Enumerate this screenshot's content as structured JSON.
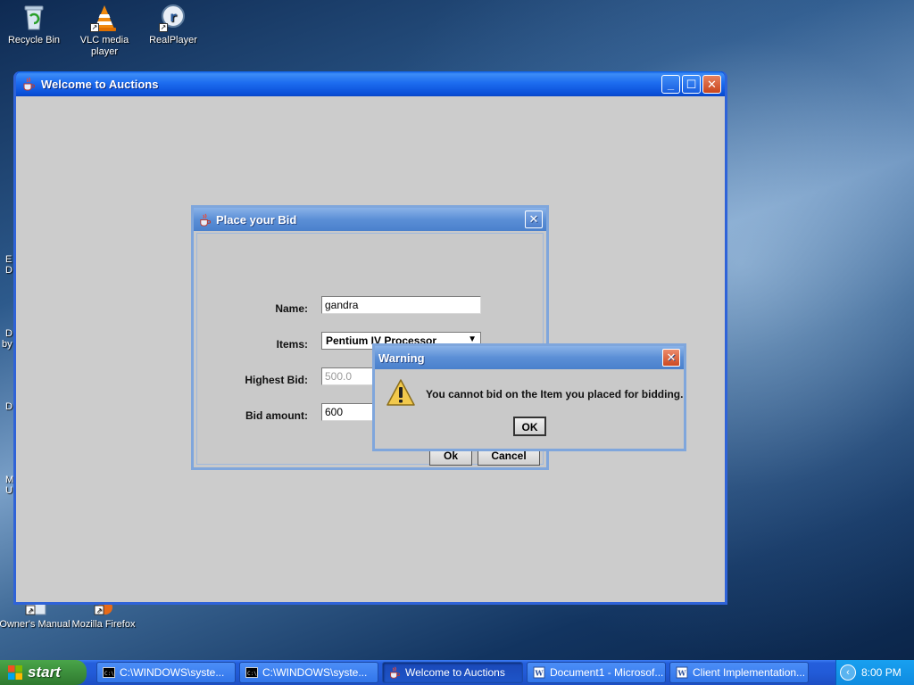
{
  "desktop": {
    "icons": [
      {
        "label": "Recycle Bin",
        "icon": "recycle-bin-icon"
      },
      {
        "label": "VLC media player",
        "icon": "vlc-icon"
      },
      {
        "label": "RealPlayer",
        "icon": "realplayer-icon"
      },
      {
        "label": "Owner's Manual",
        "icon": "manual-icon"
      },
      {
        "label": "Mozilla Firefox",
        "icon": "firefox-icon"
      }
    ],
    "edge_fragments": [
      "E",
      "D",
      "D",
      "by",
      "D",
      "M",
      "U"
    ]
  },
  "main_window": {
    "title": "Welcome to Auctions",
    "icon": "java-cup-icon",
    "controls": {
      "minimize": "minimize-icon",
      "maximize": "maximize-icon",
      "close": "close-icon"
    }
  },
  "bid_dialog": {
    "title": "Place your Bid",
    "icon": "java-cup-icon",
    "fields": {
      "name_label": "Name:",
      "name_value": "gandra",
      "items_label": "Items:",
      "items_value": "Pentium IV Processor",
      "highest_bid_label": "Highest Bid:",
      "highest_bid_value": "500.0",
      "bid_amount_label": "Bid amount:",
      "bid_amount_value": "600"
    },
    "buttons": {
      "ok": "Ok",
      "cancel": "Cancel"
    }
  },
  "warning_dialog": {
    "title": "Warning",
    "icon": "warning-icon",
    "message": "You cannot bid on the Item you placed for bidding.",
    "ok_label": "OK"
  },
  "taskbar": {
    "start_label": "start",
    "tasks": [
      {
        "label": "C:\\WINDOWS\\syste...",
        "icon": "cmd-icon",
        "active": false
      },
      {
        "label": "C:\\WINDOWS\\syste...",
        "icon": "cmd-icon",
        "active": false
      },
      {
        "label": "Welcome to Auctions",
        "icon": "java-cup-icon",
        "active": true
      },
      {
        "label": "Document1 - Microsof...",
        "icon": "word-icon",
        "active": false
      },
      {
        "label": "Client Implementation...",
        "icon": "word-icon",
        "active": false
      }
    ],
    "clock": "8:00 PM"
  },
  "colors": {
    "xp_title_blue": "#0a5ce6",
    "java_title_blue": "#5b8fd6",
    "dialog_bg": "#c9c9c9",
    "start_green": "#3c8f3c",
    "close_red": "#cc4a22"
  }
}
